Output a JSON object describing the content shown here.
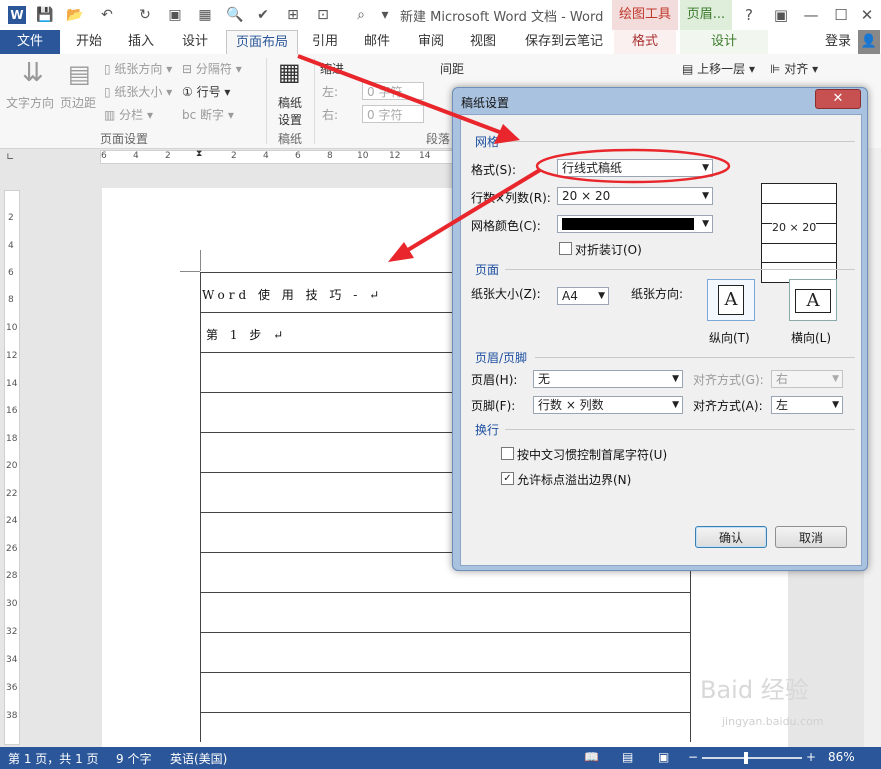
{
  "titlebar": {
    "doc_title": "新建 Microsoft Word 文档 - Word",
    "context_tab_draw": "绘图工具",
    "context_tab_header": "页眉...",
    "help": "?",
    "minimize": "—",
    "maximize": "☐",
    "close": "✕",
    "word_logo": "W"
  },
  "tabs": [
    "文件",
    "开始",
    "插入",
    "设计",
    "页面布局",
    "引用",
    "邮件",
    "审阅",
    "视图",
    "保存到云笔记",
    "格式",
    "设计"
  ],
  "login": "登录",
  "ribbon": {
    "text_direction": "文字方向",
    "margins": "页边距",
    "orientation": "纸张方向",
    "size": "纸张大小",
    "columns": "分栏",
    "breaks": "分隔符",
    "line_numbers": "行号",
    "hyphenation": "断字",
    "group_page_setup": "页面设置",
    "manuscript": "稿纸",
    "manuscript_setup": "设置",
    "group_manuscript": "稿纸",
    "indent": "缩进",
    "spacing": "间距",
    "indent_left_label": "左:",
    "indent_right_label": "右:",
    "indent_left_value": "0 字符",
    "indent_right_value": "0 字符",
    "group_paragraph": "段落",
    "bring_forward": "上移一层",
    "align": "对齐"
  },
  "ruler_h": [
    "6",
    "4",
    "2",
    "2",
    "4",
    "6",
    "8",
    "10",
    "12",
    "14"
  ],
  "ruler_v": [
    "2",
    "4",
    "6",
    "8",
    "10",
    "12",
    "14",
    "16",
    "18",
    "20",
    "22",
    "24",
    "26",
    "28",
    "30",
    "32",
    "34",
    "36",
    "38"
  ],
  "document": {
    "line1": "Word 使 用 技 巧 - ↵",
    "line2": "第 1 步 ↵"
  },
  "dialog": {
    "title": "稿纸设置",
    "close": "✕",
    "section_grid": "网格",
    "format_label": "格式(S):",
    "format_value": "行线式稿纸",
    "rows_cols_label": "行数×列数(R):",
    "rows_cols_value": "20 × 20",
    "grid_color_label": "网格颜色(C):",
    "fold_binding_label": "对折装订(O)",
    "preview_text": "20 × 20",
    "section_page": "页面",
    "paper_size_label": "纸张大小(Z):",
    "paper_size_value": "A4",
    "orientation_label": "纸张方向:",
    "portrait_label": "纵向(T)",
    "landscape_label": "横向(L)",
    "section_header_footer": "页眉/页脚",
    "header_label": "页眉(H):",
    "header_value": "无",
    "header_align_label": "对齐方式(G):",
    "header_align_value": "右",
    "footer_label": "页脚(F):",
    "footer_value": "行数 × 列数",
    "footer_align_label": "对齐方式(A):",
    "footer_align_value": "左",
    "section_linebreak": "换行",
    "opt1_label": "按中文习惯控制首尾字符(U)",
    "opt2_label": "允许标点溢出边界(N)",
    "ok": "确认",
    "cancel": "取消"
  },
  "status": {
    "page": "第 1 页，共 1 页",
    "words": "9 个字",
    "language": "英语(美国)",
    "zoom": "86%"
  },
  "watermark": {
    "brand": "Baid 经验",
    "url": "jingyan.baidu.com"
  },
  "colors": {
    "accent": "#2b579a",
    "annotation_red": "#e8262b",
    "context_draw": "#f3dcdc",
    "context_header": "#dfeedb"
  }
}
